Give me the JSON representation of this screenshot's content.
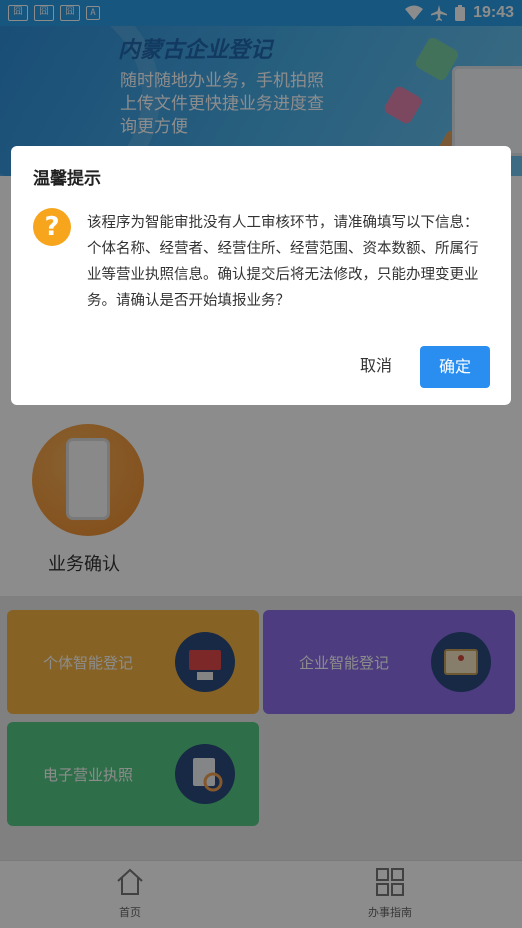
{
  "status_bar": {
    "left_icons": [
      "notification-icon",
      "notification-icon",
      "notification-icon",
      "text-icon"
    ],
    "right_icons": [
      "wifi-icon",
      "airplane-icon",
      "battery-icon"
    ],
    "time": "19:43"
  },
  "banner": {
    "title": "内蒙古企业登记",
    "text": "随时随地办业务，手机拍照上传文件更快捷业务进度查询更方便"
  },
  "menu": {
    "biz_confirm_label": "业务确认"
  },
  "cards": [
    {
      "label": "个体智能登记",
      "icon": "computer-icon"
    },
    {
      "label": "企业智能登记",
      "icon": "certificate-icon"
    },
    {
      "label": "电子营业执照",
      "icon": "license-icon"
    }
  ],
  "bottom_nav": [
    {
      "label": "首页",
      "icon": "home-icon"
    },
    {
      "label": "办事指南",
      "icon": "grid-icon"
    }
  ],
  "dialog": {
    "title": "温馨提示",
    "icon": "question-icon",
    "message": "该程序为智能审批没有人工审核环节，请准确填写以下信息：个体名称、经营者、经营住所、经营范围、资本数额、所属行业等营业执照信息。确认提交后将无法修改，只能办理变更业务。请确认是否开始填报业务？",
    "cancel_label": "取消",
    "confirm_label": "确定"
  },
  "colors": {
    "status_bar": "#2a9de8",
    "card_yellow": "#f5b343",
    "card_purple": "#8c6ee8",
    "card_green": "#55c985",
    "confirm_button": "#2a8ef0",
    "warn_icon": "#f7a51c"
  }
}
